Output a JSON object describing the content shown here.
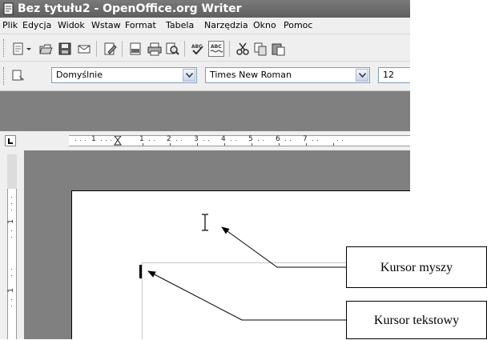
{
  "window": {
    "title": "Bez tytułu2 - OpenOffice.org Writer",
    "app_icon": "writer-document-icon"
  },
  "menubar": {
    "items": [
      {
        "label": "Plik"
      },
      {
        "label": "Edycja"
      },
      {
        "label": "Widok"
      },
      {
        "label": "Wstaw"
      },
      {
        "label": "Format"
      },
      {
        "label": "Tabela"
      },
      {
        "label": "Narzędzia"
      },
      {
        "label": "Okno"
      },
      {
        "label": "Pomoc"
      }
    ]
  },
  "toolbar_standard": {
    "icons": [
      "new-document-icon",
      "dropdown-arrow-icon",
      "open-folder-icon",
      "save-icon",
      "email-icon",
      "edit-file-icon",
      "export-pdf-icon",
      "print-icon",
      "page-preview-icon",
      "spellcheck-icon",
      "autospellcheck-icon",
      "cut-icon",
      "copy-icon",
      "paste-icon"
    ]
  },
  "toolbar_formatting": {
    "styles_icon": "styles-formatting-icon",
    "paragraph_style": "Domyślnie",
    "font_name": "Times New Roman",
    "font_size": "12"
  },
  "ruler": {
    "corner_icon": "tab-stop-left-icon",
    "labels": [
      "1",
      "1",
      "2",
      "3",
      "4",
      "5",
      "6",
      "7"
    ]
  },
  "vertical_ruler": {
    "labels": [
      "1",
      "1"
    ]
  },
  "annotations": {
    "mouse_cursor_label": "Kursor myszy",
    "text_cursor_label": "Kursor tekstowy"
  }
}
